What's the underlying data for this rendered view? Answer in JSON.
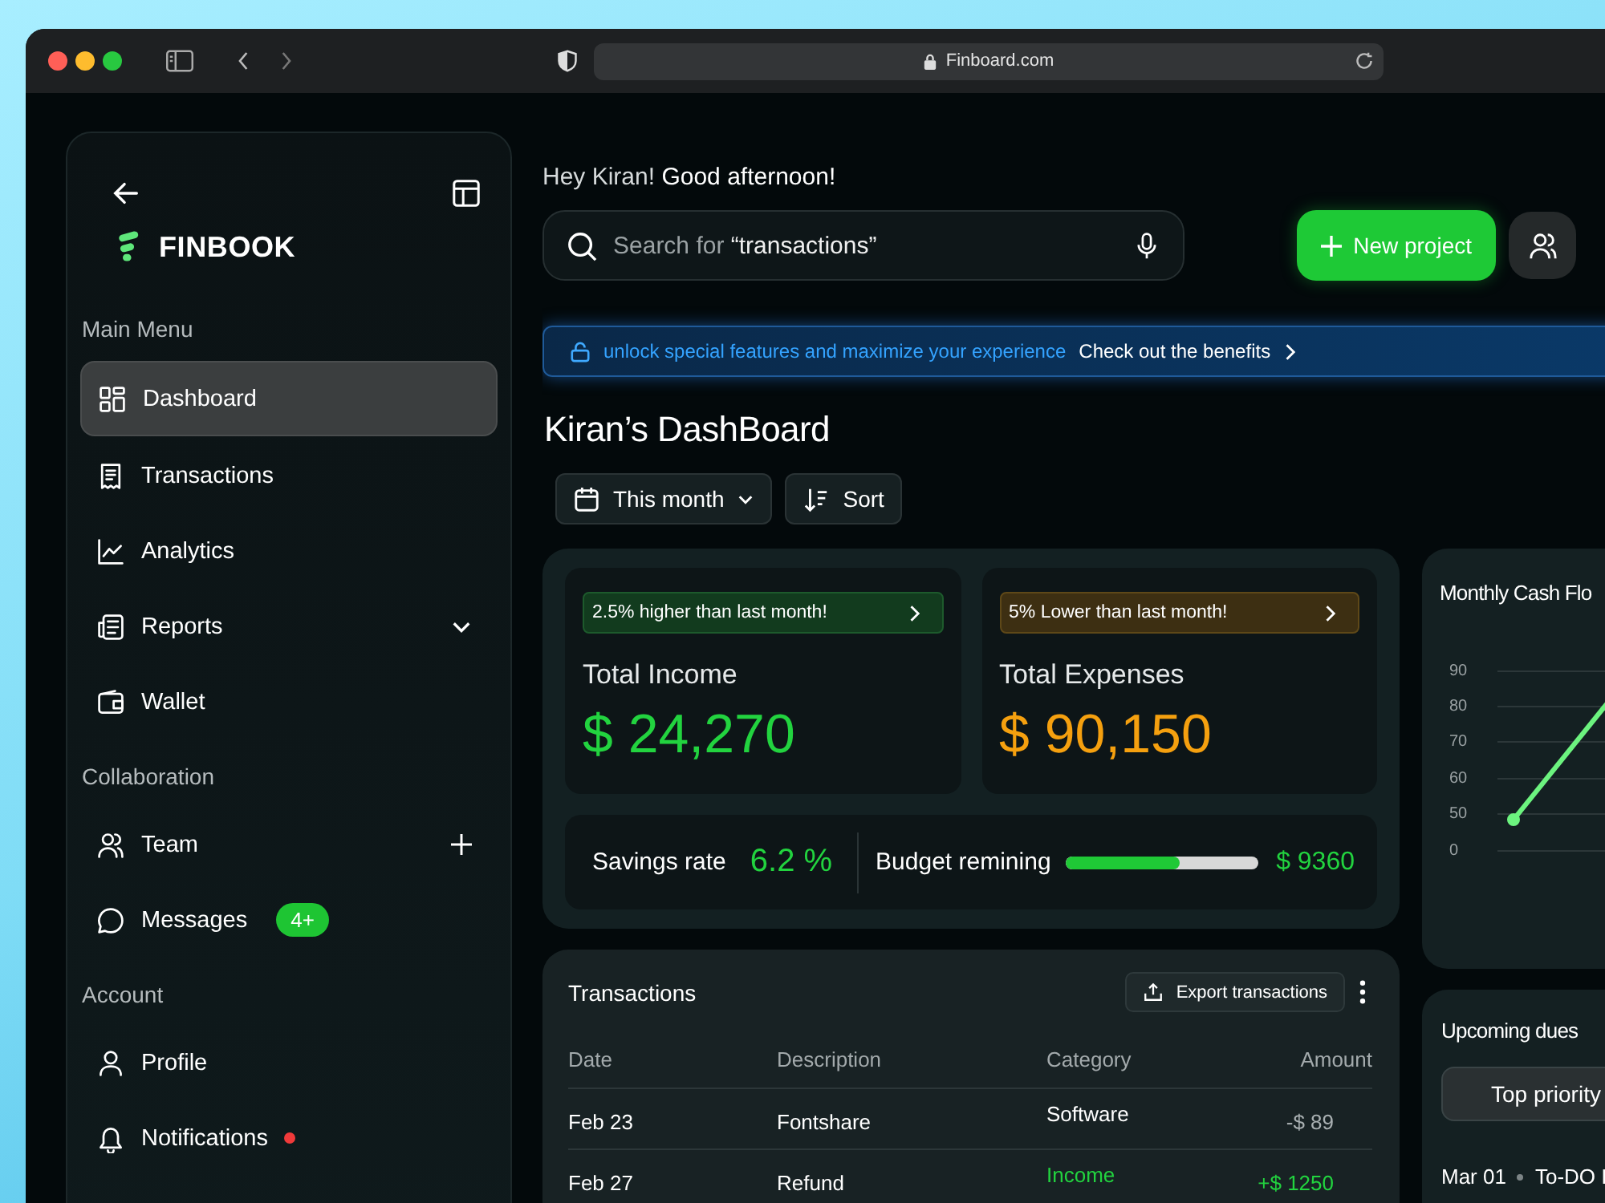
{
  "browser": {
    "url": "Finboard.com"
  },
  "sidebar": {
    "logo": "FINBOOK",
    "sections": [
      {
        "title": "Main Menu",
        "items": [
          {
            "label": "Dashboard",
            "selected": true
          },
          {
            "label": "Transactions",
            "selected": false
          },
          {
            "label": "Analytics",
            "selected": false
          },
          {
            "label": "Reports",
            "selected": false,
            "expanded": false
          },
          {
            "label": "Wallet",
            "selected": false
          }
        ]
      },
      {
        "title": "Collaboration",
        "items": [
          {
            "label": "Team",
            "selected": false,
            "addable": true
          },
          {
            "label": "Messages",
            "selected": false,
            "badge": "4+"
          }
        ]
      },
      {
        "title": "Account",
        "items": [
          {
            "label": "Profile",
            "selected": false
          },
          {
            "label": "Notifications",
            "selected": false,
            "unread": true
          }
        ]
      }
    ]
  },
  "greeting": "Hey Kiran! **Good afternoon!**",
  "search": {
    "placeholder": "Search for **“transactions”**"
  },
  "new_project_button": "New project",
  "banner": {
    "message": "unlock special features and maximize your experience",
    "link": "Check out the benefits"
  },
  "dashboard_title": "Kiran’s DashBoard",
  "filters": [
    {
      "label": "This month",
      "kind": "period"
    },
    {
      "label": "Sort",
      "kind": "sort"
    }
  ],
  "summary_cards": [
    {
      "kind": "income",
      "trend": "2.5% higher than last month!",
      "title": "Total Income",
      "amount": "$ 24,270"
    },
    {
      "kind": "expense",
      "trend": "5% Lower than last month!",
      "title": "Total Expenses",
      "amount": "$ 90,150"
    }
  ],
  "savings": {
    "label": "Savings rate",
    "value": "6.2 %"
  },
  "budget": {
    "label": "Budget remining",
    "level": 0.59,
    "amount": "$ 9360"
  },
  "transactions": {
    "title": "Transactions",
    "export_button": "Export transactions",
    "columns": [
      "Date",
      "Description",
      "Category",
      "Amount"
    ],
    "rows": [
      {
        "kind": "expense",
        "date": "Feb 23",
        "description": "Fontshare",
        "category": "Software",
        "amount": "-$ 89"
      },
      {
        "kind": "income",
        "date": "Feb 27",
        "description": "Refund",
        "category": "Income",
        "amount": "+$ 1250"
      }
    ]
  },
  "cash_flow": {
    "title": "Monthly Cash Flo",
    "y_labels": [
      "90",
      "80",
      "70",
      "60",
      "50",
      "0"
    ]
  },
  "upcoming_dues": {
    "title": "Upcoming dues",
    "tabs": [
      {
        "label": "Top priority",
        "selected": true
      }
    ],
    "items": [
      {
        "date": "Mar 01",
        "title": "To-DO I"
      }
    ]
  }
}
